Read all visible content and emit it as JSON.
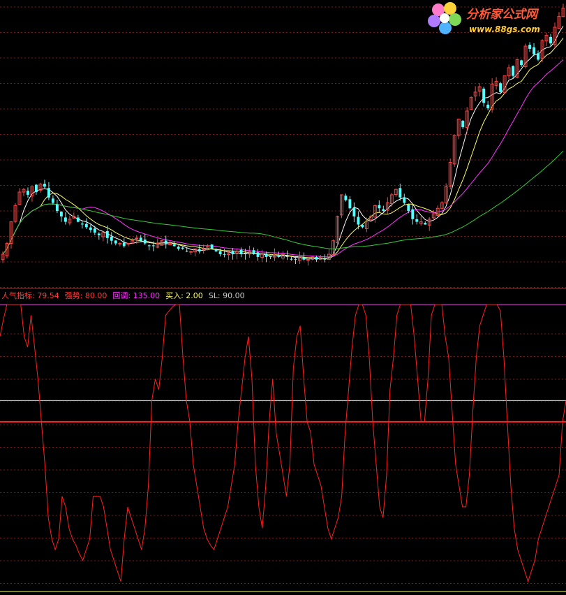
{
  "watermark": {
    "name": "分析家公式网",
    "url": "www.88gs.com"
  },
  "indicator_legend": [
    {
      "label": "人气指标",
      "value": "79.54",
      "color": "#ff3b3b"
    },
    {
      "label": "强势",
      "value": "80.00",
      "color": "#ff3b3b"
    },
    {
      "label": "回调",
      "value": "135.00",
      "color": "#ff33ff"
    },
    {
      "label": "买入",
      "value": "2.00",
      "color": "#ffff66"
    },
    {
      "label": "SL",
      "value": "90.00",
      "color": "#cccccc"
    }
  ],
  "colors": {
    "background": "#000000",
    "grid": "#7a1a1a",
    "candle_up": "#ff4040",
    "candle_down": "#54ffff",
    "ma5": "#ffffff",
    "ma10": "#ffff66",
    "ma20": "#ff33ff",
    "ma60": "#33cc33",
    "indicator": "#ff2020",
    "ref_sl": "#cccccc",
    "ref_mid": "#ff2020",
    "separator": "#b03030"
  },
  "chart_data": [
    {
      "type": "candlestick",
      "title": "",
      "grid": true,
      "y_unit": "price (unlabeled, relative)",
      "ylim": [
        0,
        100
      ],
      "note_values": "estimated relative price levels",
      "closes": [
        8,
        12,
        20,
        26,
        31,
        32,
        30,
        33,
        31,
        34,
        33,
        29,
        27,
        24,
        22,
        20,
        21,
        22,
        20,
        19,
        18,
        17,
        16,
        15,
        16,
        14,
        13,
        12,
        12,
        11,
        12,
        13,
        14,
        13,
        12,
        11,
        11,
        12,
        13,
        12,
        12,
        11,
        10,
        10,
        9,
        9,
        10,
        9,
        10,
        11,
        10,
        9,
        8,
        8,
        9,
        8,
        9,
        8,
        8,
        9,
        8,
        7,
        8,
        7,
        7,
        8,
        7,
        8,
        7,
        6,
        6,
        7,
        6,
        6,
        7,
        6,
        7,
        6,
        8,
        13,
        22,
        30,
        28,
        25,
        22,
        19,
        18,
        20,
        22,
        26,
        25,
        24,
        27,
        30,
        32,
        29,
        27,
        24,
        21,
        20,
        20,
        19,
        21,
        23,
        25,
        27,
        33,
        42,
        52,
        58,
        55,
        61,
        66,
        68,
        70,
        64,
        62,
        71,
        72,
        68,
        74,
        77,
        74,
        80,
        78,
        85,
        84,
        82,
        80,
        87,
        89,
        86,
        92,
        96,
        99
      ],
      "ma_periods": [
        5,
        10,
        20,
        60
      ]
    },
    {
      "type": "line",
      "title": "",
      "series": [
        {
          "name": "人气指标",
          "last_value": 79.54
        }
      ],
      "ylim": [
        0,
        135
      ],
      "reference_lines": [
        {
          "name": "强势",
          "value": 80
        },
        {
          "name": "回调",
          "value": 135
        },
        {
          "name": "SL",
          "value": 90
        }
      ],
      "note_values": "estimated oscillator values",
      "values": [
        120,
        128,
        135,
        135,
        135,
        135,
        135,
        120,
        115,
        130,
        115,
        100,
        80,
        60,
        35,
        25,
        20,
        25,
        45,
        40,
        30,
        25,
        22,
        18,
        15,
        20,
        25,
        45,
        45,
        45,
        40,
        30,
        20,
        15,
        10,
        5,
        25,
        40,
        35,
        30,
        25,
        20,
        30,
        50,
        90,
        100,
        95,
        110,
        130,
        132,
        134,
        135,
        135,
        110,
        90,
        80,
        60,
        50,
        40,
        30,
        25,
        22,
        20,
        25,
        30,
        35,
        40,
        50,
        60,
        80,
        95,
        110,
        120,
        100,
        60,
        40,
        30,
        50,
        80,
        100,
        75,
        65,
        55,
        45,
        60,
        105,
        120,
        125,
        100,
        80,
        75,
        60,
        55,
        50,
        40,
        30,
        25,
        30,
        35,
        45,
        75,
        95,
        115,
        130,
        135,
        135,
        130,
        110,
        80,
        60,
        40,
        35,
        55,
        95,
        110,
        130,
        135,
        135,
        135,
        135,
        120,
        100,
        80,
        80,
        100,
        130,
        135,
        135,
        135,
        120,
        110,
        85,
        60,
        50,
        40,
        40,
        55,
        85,
        110,
        125,
        130,
        135,
        135,
        135,
        135,
        132,
        110,
        80,
        50,
        30,
        20,
        15,
        10,
        5,
        10,
        15,
        25,
        30,
        35,
        40,
        45,
        50,
        55,
        80,
        90
      ]
    }
  ]
}
